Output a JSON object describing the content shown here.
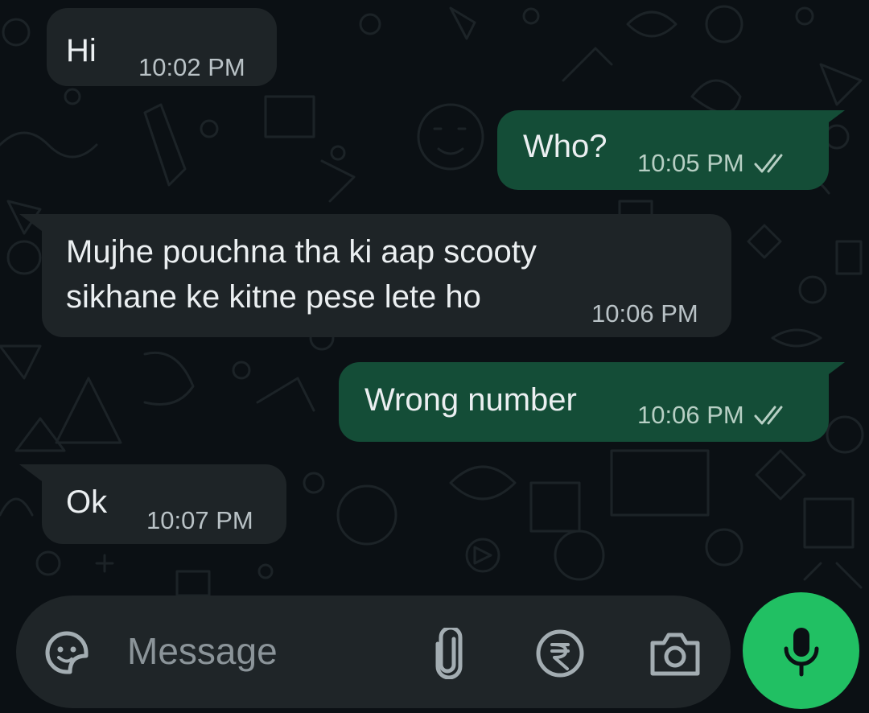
{
  "messages": [
    {
      "direction": "incoming",
      "text": "Hi",
      "time": "10:02 PM"
    },
    {
      "direction": "outgoing",
      "text": "Who?",
      "time": "10:05 PM",
      "status": "read"
    },
    {
      "direction": "incoming",
      "text_line1": "Mujhe pouchna tha ki aap scooty",
      "text_line2": "sikhane ke kitne pese lete ho",
      "time": "10:06 PM"
    },
    {
      "direction": "outgoing",
      "text": "Wrong number",
      "time": "10:06 PM",
      "status": "read"
    },
    {
      "direction": "incoming",
      "text": "Ok",
      "time": "10:07 PM"
    }
  ],
  "composer": {
    "placeholder": "Message",
    "emoji_icon": "sticker-emoji-icon",
    "attach_icon": "paperclip-icon",
    "payment_icon": "rupee-icon",
    "camera_icon": "camera-icon",
    "mic_icon": "microphone-icon"
  },
  "colors": {
    "background": "#0b1014",
    "incoming_bubble": "#1e2427",
    "outgoing_bubble": "#144d37",
    "accent": "#21c063",
    "read_tick": "#b7cfc4"
  }
}
